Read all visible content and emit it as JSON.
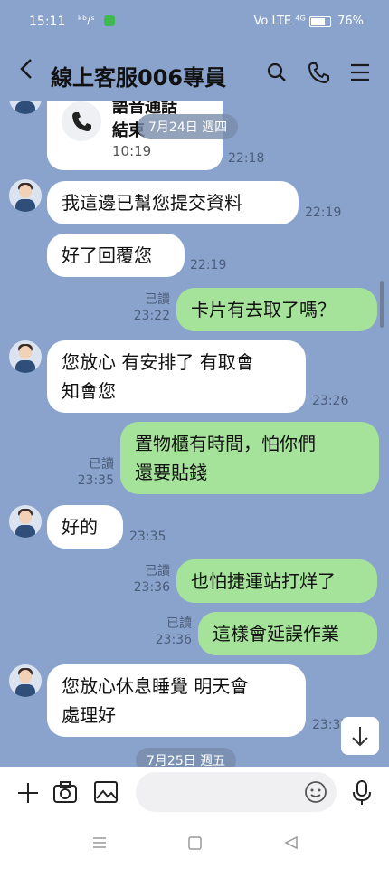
{
  "status_bar": {
    "time": "15:11",
    "left_icons": "ᵏᵇ/ˢ",
    "right_icons": "Vo LTE ⁴ᴳ",
    "battery": "76%"
  },
  "header": {
    "back_icon": "chevron-left-icon",
    "title": "線上客服006專員",
    "icons": [
      "search-icon",
      "phone-icon",
      "menu-icon"
    ]
  },
  "chat": {
    "call_card": {
      "line1": "語音通話",
      "line2": "結束",
      "time": "10:19",
      "side_time": "22:18"
    },
    "date_pill_1": "7月24日 週四",
    "messages": [
      {
        "side": "left",
        "text": "我這邊已幫您提交資料",
        "time": "22:19"
      },
      {
        "side": "left",
        "text": "好了回覆您",
        "time": "22:19"
      },
      {
        "side": "right",
        "text": "卡片有去取了嗎？",
        "read": "已讀",
        "time": "23:22"
      },
      {
        "side": "left",
        "text_lines": [
          "您放心 有安排了 有取會",
          "知會您"
        ],
        "time": "23:26"
      },
      {
        "side": "right",
        "text_lines": [
          "置物櫃有時間，怕你們",
          "還要貼錢"
        ],
        "read": "已讀",
        "time": "23:35"
      },
      {
        "side": "left",
        "text": "好的",
        "time": "23:35"
      },
      {
        "side": "right",
        "text": "也怕捷運站打烊了",
        "read": "已讀",
        "time": "23:36"
      },
      {
        "side": "right",
        "text": "這樣會延誤作業",
        "read": "已讀",
        "time": "23:36"
      },
      {
        "side": "left",
        "text_lines": [
          "您放心休息睡覺 明天會",
          "處理好"
        ],
        "time": "23:37"
      }
    ],
    "date_pill_2": "7月25日 週五",
    "scroll_down_icon": "chevron-down-icon"
  },
  "input_bar": {
    "icons": [
      "plus-icon",
      "camera-icon",
      "image-icon",
      "emoji-icon",
      "microphone-icon"
    ],
    "placeholder": ""
  },
  "nav_bar": {
    "icons": [
      "recents-icon",
      "home-icon",
      "back-icon"
    ]
  }
}
